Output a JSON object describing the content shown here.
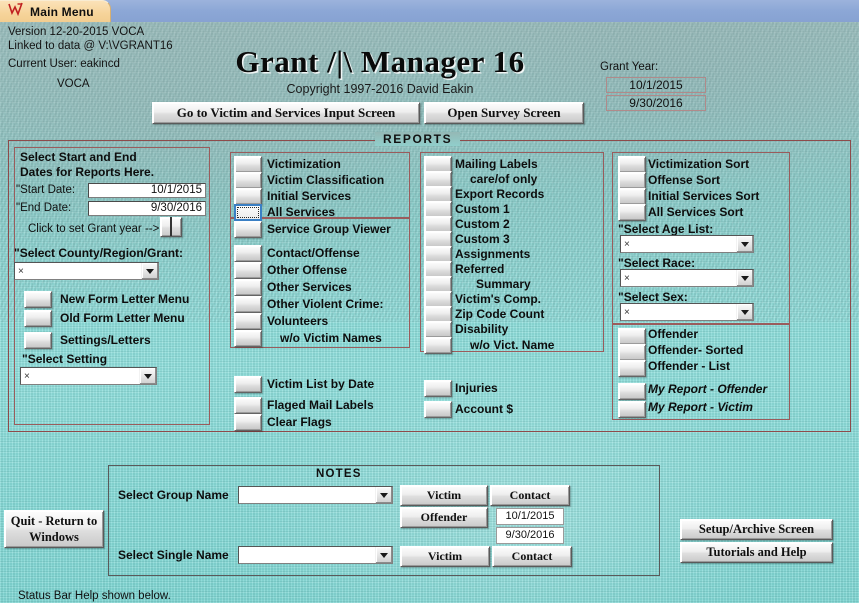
{
  "window": {
    "tab_label": "Main Menu",
    "tab_icon": "chart-icon"
  },
  "header": {
    "version": "Version 12-20-2015  VOCA",
    "linked": "Linked to data @ V:\\VGRANT16",
    "current_user": "Current User:   eakincd",
    "org": "VOCA",
    "title": "Grant /|\\ Manager 16",
    "copyright": "Copyright 1997-2016  David Eakin",
    "grant_year_label": "Grant Year:",
    "grant_year_start": "10/1/2015",
    "grant_year_end": "9/30/2016"
  },
  "top_buttons": {
    "victim_input": "Go to Victim and Services Input Screen",
    "survey": "Open Survey Screen"
  },
  "reports": {
    "legend": "REPORTS",
    "left_panel": {
      "title_line1": "Select Start and End",
      "title_line2": "Dates for Reports Here.",
      "start_label": "\"Start Date:",
      "end_label": "\"End  Date:",
      "start_value": "10/1/2015",
      "end_value": "9/30/2016",
      "calendar_hint": "Click to set Grant year -->",
      "county_label": "\"Select County/Region/Grant:",
      "county_value": "×",
      "buttons": [
        "New Form Letter Menu",
        "Old Form Letter Menu",
        "Settings/Letters"
      ],
      "setting_label": "\"Select Setting",
      "setting_value": "×"
    },
    "column1_group_a": [
      "Victimization",
      "Victim Classification",
      "Initial Services",
      "All Services",
      "Service Group Viewer"
    ],
    "column1_focused_index": 3,
    "column1_group_b": [
      "Contact/Offense",
      "Other Offense",
      "Other Services",
      "Other Violent Crime:",
      "Volunteers",
      "w/o Victim Names"
    ],
    "column1_group_c": [
      "Victim List by Date",
      "Flaged Mail Labels",
      "Clear Flags"
    ],
    "column2_group_a": [
      "Mailing Labels",
      "care/of only",
      "Export Records",
      "Custom 1",
      "Custom 2",
      "Custom 3",
      "Assignments",
      "Referred",
      "Summary",
      "Victim's Comp.",
      "Zip Code Count",
      "Disability",
      "w/o Vict. Name"
    ],
    "column2_group_b": [
      "Injuries",
      "Account $"
    ],
    "column3_sorts": [
      "Victimization Sort",
      "Offense Sort",
      "Initial Services Sort",
      "All Services Sort"
    ],
    "column3_selects": [
      {
        "label": "\"Select Age List:",
        "value": "×"
      },
      {
        "label": "\"Select Race:",
        "value": "×"
      },
      {
        "label": "\"Select Sex:",
        "value": "×"
      }
    ],
    "column3_offender": [
      "Offender",
      "Offender- Sorted",
      "Offender - List"
    ],
    "column3_myreport": [
      "My Report - Offender",
      "My Report - Victim"
    ]
  },
  "notes": {
    "legend": "NOTES",
    "group_label": "Select Group Name",
    "group_value": "",
    "single_label": "Select Single Name",
    "single_value": "",
    "btn_victim_1": "Victim",
    "btn_contact_1": "Contact",
    "btn_offender": "Offender",
    "btn_victim_2": "Victim",
    "btn_contact_2": "Contact",
    "date_start": "10/1/2015",
    "date_end": "9/30/2016"
  },
  "footer": {
    "quit": "Quit - Return to Windows",
    "setup": "Setup/Archive Screen",
    "tutorials": "Tutorials and Help",
    "status": "Status Bar Help shown below."
  },
  "colors": {
    "canvas": "#8ed8d4",
    "titlebar": "#8ca7d6",
    "tab": "#f6d49a",
    "groupbox_border": "#8d4b4b",
    "focus": "#3a7fc4"
  }
}
